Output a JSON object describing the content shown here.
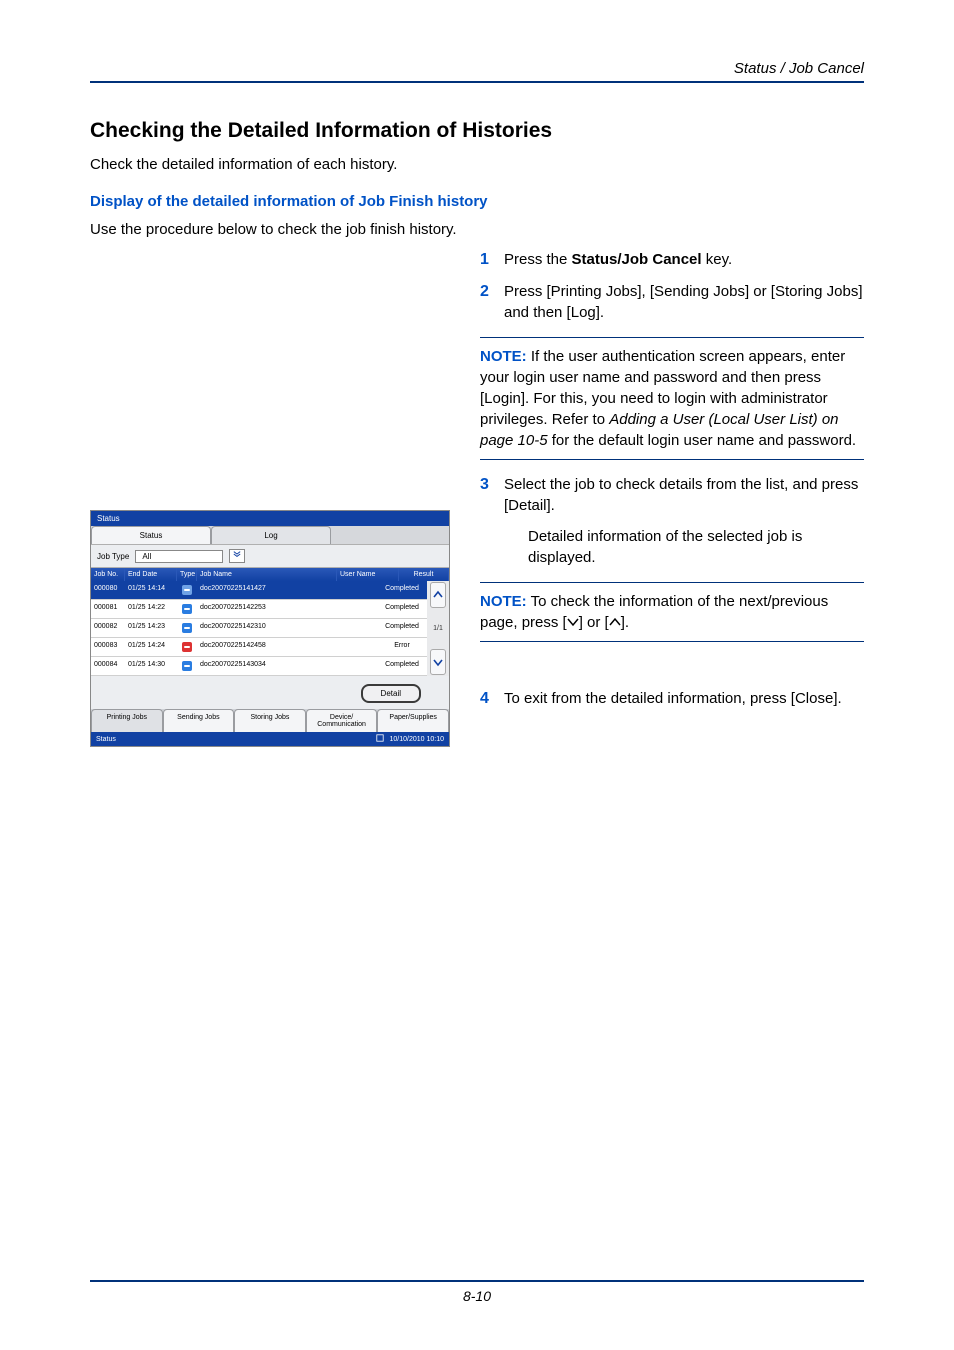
{
  "header": {
    "section": "Status / Job Cancel"
  },
  "title": "Checking the Detailed Information of Histories",
  "intro": "Check the detailed information of each history.",
  "subhead": "Display of the detailed information of Job Finish history",
  "lead": "Use the procedure below to check the job finish history.",
  "steps": {
    "s1": {
      "num": "1",
      "prefix": "Press the ",
      "bold": "Status/Job Cancel",
      "suffix": " key."
    },
    "s2": {
      "num": "2",
      "text": "Press [Printing Jobs], [Sending Jobs] or [Storing Jobs] and then [Log]."
    },
    "s3": {
      "num": "3",
      "text1": "Select the job to check details from the list, and press [Detail].",
      "text2": "Detailed information of the selected job is displayed."
    },
    "s4": {
      "num": "4",
      "text": "To exit from the detailed information, press [Close]."
    }
  },
  "note1": {
    "label": "NOTE:",
    "t1": " If the user authentication screen appears, enter your login user name and password and then press [Login]. For this, you need to login with administrator privileges. Refer to ",
    "ref": "Adding a User (Local User List) on page 10-5",
    "t2": " for the default login user name and password."
  },
  "note2": {
    "label": "NOTE:",
    "t1": " To check the information of the next/previous page, press [",
    "t2": "] or [",
    "t3": "]."
  },
  "footer": {
    "pagenum": "8-10"
  },
  "screenshot": {
    "titlebar": "Status",
    "tabs": {
      "status": "Status",
      "log": "Log"
    },
    "jobtype_label": "Job Type",
    "jobtype_value": "All",
    "headers": {
      "no": "Job No.",
      "date": "End Date",
      "type": "Type",
      "name": "Job Name",
      "user": "User Name",
      "result": "Result"
    },
    "page_indicator": "1/1",
    "rows": [
      {
        "no": "000080",
        "date": "01/25 14:14",
        "name": "doc20070225141427",
        "user": "",
        "result": "Completed",
        "selected": true,
        "err": false
      },
      {
        "no": "000081",
        "date": "01/25 14:22",
        "name": "doc20070225142253",
        "user": "",
        "result": "Completed",
        "selected": false,
        "err": false
      },
      {
        "no": "000082",
        "date": "01/25 14:23",
        "name": "doc20070225142310",
        "user": "",
        "result": "Completed",
        "selected": false,
        "err": false
      },
      {
        "no": "000083",
        "date": "01/25 14:24",
        "name": "doc20070225142458",
        "user": "",
        "result": "Error",
        "selected": false,
        "err": true
      },
      {
        "no": "000084",
        "date": "01/25 14:30",
        "name": "doc20070225143034",
        "user": "",
        "result": "Completed",
        "selected": false,
        "err": false
      }
    ],
    "detail_button": "Detail",
    "footer_tabs": {
      "printing": "Printing Jobs",
      "sending": "Sending Jobs",
      "storing": "Storing Jobs",
      "device": "Device/\nCommunication",
      "paper": "Paper/Supplies"
    },
    "statusbar": {
      "label": "Status",
      "time": "10/10/2010  10:10"
    }
  }
}
